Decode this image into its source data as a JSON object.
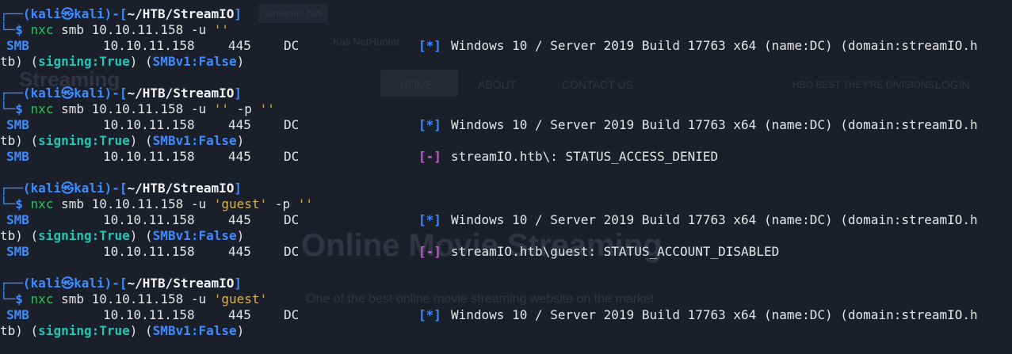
{
  "background_ghost": {
    "url_text": "streamio.htb",
    "bookmark": "Kali NetHunter",
    "site_logo": "Streaming",
    "nav_home": "HOME",
    "nav_about": "ABOUT",
    "nav_contact": "CONTACT US",
    "nav_promo": "HBO BEST THEY'RE DIVISIONS",
    "nav_login": "LOGIN",
    "headline": "Online Movie Streaming",
    "subline": "One of the best online movie streaming website on the market"
  },
  "prompt": {
    "user": "kali",
    "at": "㉿",
    "host": "kali",
    "path": "~/HTB/StreamIO",
    "symbol": "$"
  },
  "blocks": [
    {
      "command": {
        "bin": "nxc",
        "args": "smb 10.10.11.158 -u",
        "strings": "''",
        "tail": ""
      },
      "output": [
        {
          "proto": "SMB",
          "ip": "10.10.11.158",
          "port": "445",
          "host": "DC",
          "marker": "[*]",
          "message": "Windows 10 / Server 2019 Build 17763 x64 (name:DC) (domain:streamIO.h",
          "continuation": {
            "prefix": "tb) (",
            "sign_label": "signing:True",
            "mid": ") (",
            "smb1_label": "SMBv1:False",
            "suffix": ")"
          }
        }
      ]
    },
    {
      "command": {
        "bin": "nxc",
        "args": "smb 10.10.11.158 -u",
        "strings": "''",
        "tail": "-p ''"
      },
      "output": [
        {
          "proto": "SMB",
          "ip": "10.10.11.158",
          "port": "445",
          "host": "DC",
          "marker": "[*]",
          "message": "Windows 10 / Server 2019 Build 17763 x64 (name:DC) (domain:streamIO.h",
          "continuation": {
            "prefix": "tb) (",
            "sign_label": "signing:True",
            "mid": ") (",
            "smb1_label": "SMBv1:False",
            "suffix": ")"
          }
        },
        {
          "proto": "SMB",
          "ip": "10.10.11.158",
          "port": "445",
          "host": "DC",
          "marker": "[-]",
          "message": "streamIO.htb\\: STATUS_ACCESS_DENIED"
        }
      ]
    },
    {
      "command": {
        "bin": "nxc",
        "args": "smb 10.10.11.158 -u",
        "strings": "'guest'",
        "tail": "-p ''"
      },
      "output": [
        {
          "proto": "SMB",
          "ip": "10.10.11.158",
          "port": "445",
          "host": "DC",
          "marker": "[*]",
          "message": "Windows 10 / Server 2019 Build 17763 x64 (name:DC) (domain:streamIO.h",
          "continuation": {
            "prefix": "tb) (",
            "sign_label": "signing:True",
            "mid": ") (",
            "smb1_label": "SMBv1:False",
            "suffix": ")"
          }
        },
        {
          "proto": "SMB",
          "ip": "10.10.11.158",
          "port": "445",
          "host": "DC",
          "marker": "[-]",
          "message": "streamIO.htb\\guest: STATUS_ACCOUNT_DISABLED"
        }
      ]
    },
    {
      "command": {
        "bin": "nxc",
        "args": "smb 10.10.11.158 -u",
        "strings": "'guest'",
        "tail": ""
      },
      "output": [
        {
          "proto": "SMB",
          "ip": "10.10.11.158",
          "port": "445",
          "host": "DC",
          "marker": "[*]",
          "message": "Windows 10 / Server 2019 Build 17763 x64 (name:DC) (domain:streamIO.h",
          "continuation": {
            "prefix": "tb) (",
            "sign_label": "signing:True",
            "mid": ") (",
            "smb1_label": "SMBv1:False",
            "suffix": ")"
          }
        }
      ]
    }
  ],
  "colors": {
    "background": "#1b1f29",
    "prompt_blue": "#3d8bff",
    "command_green": "#22c55e",
    "string_yellow": "#d9b24a",
    "info_cyan": "#20c6b6",
    "marker_magenta": "#c061cb"
  }
}
